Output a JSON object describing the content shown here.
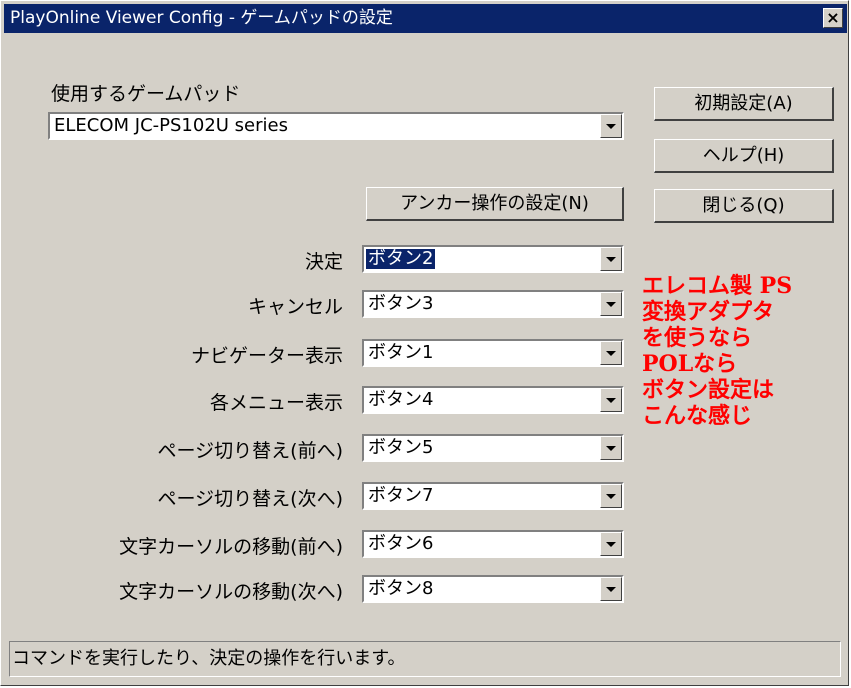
{
  "window": {
    "title": "PlayOnline Viewer Config - ゲームパッドの設定",
    "close_glyph": "×"
  },
  "gamepad": {
    "label": "使用するゲームパッド",
    "selected": "ELECOM JC-PS102U series"
  },
  "buttons": {
    "defaults": "初期設定(A)",
    "help": "ヘルプ(H)",
    "close": "閉じる(Q)",
    "anchor": "アンカー操作の設定(N)"
  },
  "mappings": [
    {
      "label": "決定",
      "value": "ボタン2"
    },
    {
      "label": "キャンセル",
      "value": "ボタン3"
    },
    {
      "label": "ナビゲーター表示",
      "value": "ボタン1"
    },
    {
      "label": "各メニュー表示",
      "value": "ボタン4"
    },
    {
      "label": "ページ切り替え(前へ)",
      "value": "ボタン5"
    },
    {
      "label": "ページ切り替え(次へ)",
      "value": "ボタン7"
    },
    {
      "label": "文字カーソルの移動(前へ)",
      "value": "ボタン6"
    },
    {
      "label": "文字カーソルの移動(次へ)",
      "value": "ボタン8"
    }
  ],
  "annotation": {
    "lines": [
      "エレコム製 PS",
      "変換アダプタ",
      "を使うなら",
      "POLなら",
      "ボタン設定は",
      "こんな感じ"
    ],
    "color": "#ff0000"
  },
  "status": "コマンドを実行したり、決定の操作を行います。",
  "colors": {
    "titlebar": "#0a246a",
    "face": "#d4d0c8",
    "selection": "#0a246a"
  }
}
